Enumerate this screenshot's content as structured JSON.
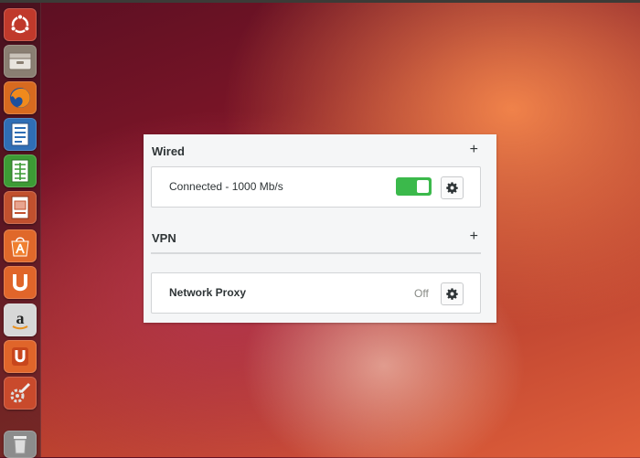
{
  "launcher": {
    "items": [
      {
        "name": "ubuntu-dash-icon"
      },
      {
        "name": "file-manager-icon"
      },
      {
        "name": "firefox-icon"
      },
      {
        "name": "libreoffice-writer-icon"
      },
      {
        "name": "libreoffice-calc-icon"
      },
      {
        "name": "libreoffice-impress-icon"
      },
      {
        "name": "software-center-icon"
      },
      {
        "name": "ubuntu-one-icon"
      },
      {
        "name": "amazon-icon"
      },
      {
        "name": "ubuntu-one-music-icon"
      },
      {
        "name": "system-settings-icon"
      },
      {
        "name": "trash-icon"
      }
    ]
  },
  "network": {
    "wired": {
      "title": "Wired",
      "add_symbol": "+",
      "connection_label": "Connected - 1000 Mb/s",
      "toggle_on": true
    },
    "vpn": {
      "title": "VPN",
      "add_symbol": "+"
    },
    "proxy": {
      "title": "Network Proxy",
      "status": "Off"
    }
  },
  "colors": {
    "toggle_on": "#3bb94b",
    "panel_bg": "#f5f6f7",
    "text": "#2e3436"
  }
}
